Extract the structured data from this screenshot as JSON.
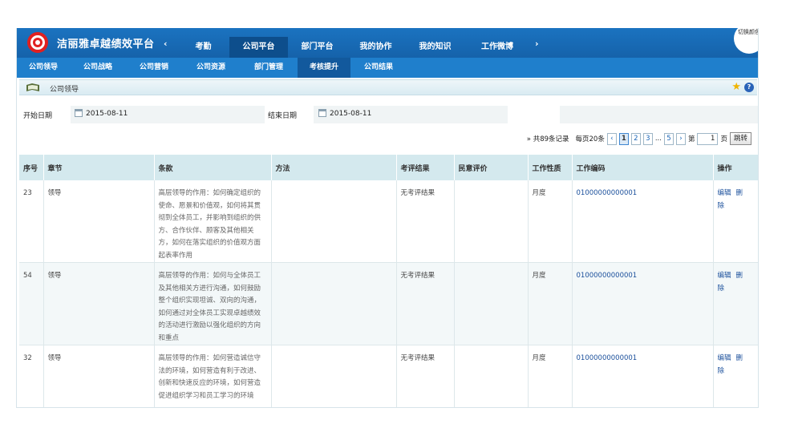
{
  "header": {
    "brand": "洁丽雅卓越绩效平台",
    "nav_prev": "‹",
    "nav_next": "›",
    "nav_items": [
      {
        "label": "考勤",
        "active": false
      },
      {
        "label": "公司平台",
        "active": true
      },
      {
        "label": "部门平台",
        "active": false
      },
      {
        "label": "我的协作",
        "active": false
      },
      {
        "label": "我的知识",
        "active": false
      },
      {
        "label": "工作微博",
        "active": false
      }
    ],
    "switch_skin": "切换颜色"
  },
  "subnav": {
    "items": [
      {
        "label": "公司领导",
        "active": false
      },
      {
        "label": "公司战略",
        "active": false
      },
      {
        "label": "公司营销",
        "active": false
      },
      {
        "label": "公司资源",
        "active": false
      },
      {
        "label": "部门管理",
        "active": false
      },
      {
        "label": "考核提升",
        "active": true
      },
      {
        "label": "公司结果",
        "active": false
      }
    ]
  },
  "breadcrumb": {
    "title": "公司领导",
    "icon": "document-folder-icon"
  },
  "filter": {
    "start_label": "开始日期",
    "start_value": "2015-08-11",
    "end_label": "结束日期",
    "end_value": "2015-08-11"
  },
  "pager": {
    "total": "» 共89条记录",
    "per_page": "每页20条",
    "prev": "‹",
    "pages": [
      "1",
      "2",
      "3"
    ],
    "ellipsis": "...",
    "last_page": "5",
    "next": "›",
    "goto_prefix": "第",
    "goto_value": "1",
    "goto_suffix": "页",
    "jump_label": "跳转"
  },
  "table": {
    "columns": [
      "序号",
      "章节",
      "条款",
      "方法",
      "考评结果",
      "民意评价",
      "工作性质",
      "工作编码",
      "操作"
    ],
    "rows": [
      {
        "no": "23",
        "chapter": "领导",
        "clause": "高层领导的作用：如何确定组织的使命、愿景和价值观，如何将其贯彻到全体员工，并影响到组织的供方、合作伙伴、顾客及其他相关方，如何在落实组织的价值观方面起表率作用",
        "method": "",
        "result": "无考评结果",
        "opinion": "",
        "nature": "月度",
        "code": "01000000000001",
        "edit": "编辑",
        "delete": "删除"
      },
      {
        "no": "54",
        "chapter": "领导",
        "clause": "高层领导的作用：如何与全体员工及其他相关方进行沟通，如何鼓励整个组织实现坦诚、双向的沟通，如何通过对全体员工实现卓越绩效的活动进行激励以强化组织的方向和重点",
        "method": "",
        "result": "无考评结果",
        "opinion": "",
        "nature": "月度",
        "code": "01000000000001",
        "edit": "编辑",
        "delete": "删除"
      },
      {
        "no": "32",
        "chapter": "领导",
        "clause": "高层领导的作用：如何营造诚信守法的环境，如何营造有利于改进、创新和快速反应的环境，如何营造促进组织学习和员工学习的环境",
        "method": "",
        "result": "无考评结果",
        "opinion": "",
        "nature": "月度",
        "code": "01000000000001",
        "edit": "编辑",
        "delete": "删除"
      }
    ]
  },
  "colors": {
    "topbar": "#1562aa",
    "subnav": "#1f7fcc",
    "active_tab": "#0d4e8c",
    "table_header": "#d4e9ee"
  }
}
